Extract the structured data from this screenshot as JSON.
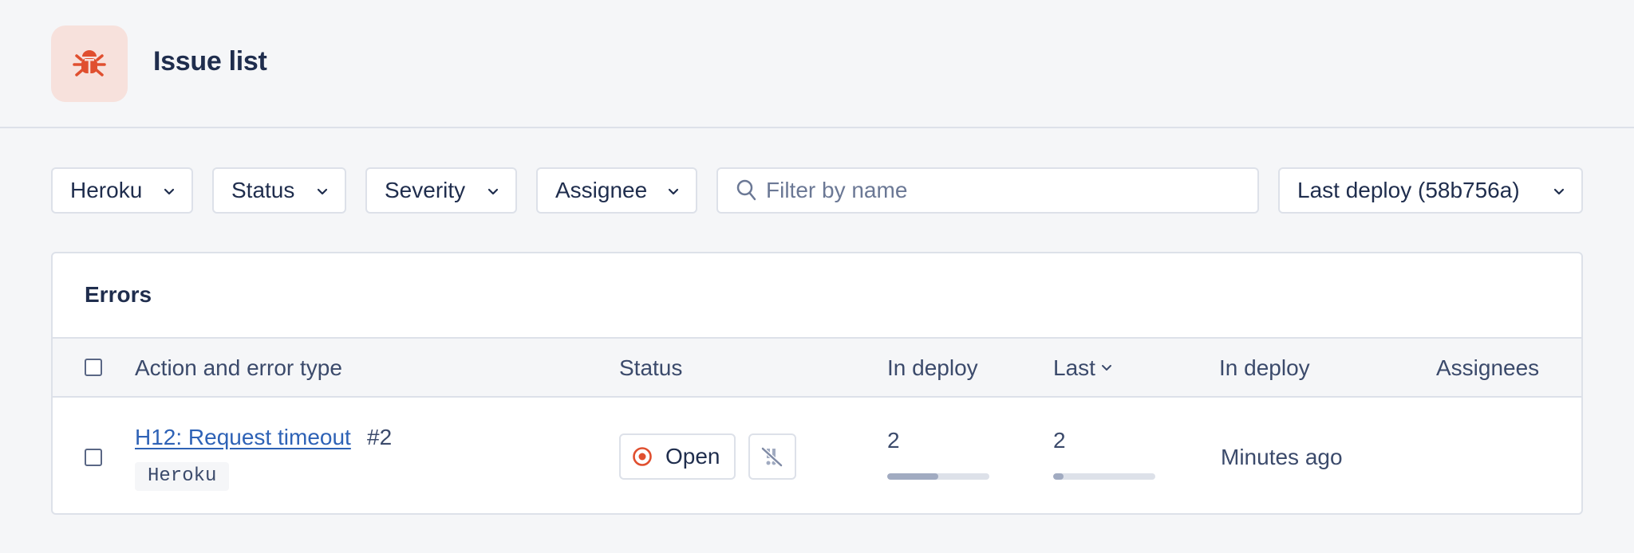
{
  "header": {
    "title": "Issue list",
    "icon": "bug-icon",
    "icon_color": "#e04f2f",
    "icon_bg": "#f7e1dc"
  },
  "filters": {
    "app": "Heroku",
    "status": "Status",
    "severity": "Severity",
    "assignee": "Assignee",
    "search_placeholder": "Filter by name",
    "search_value": "",
    "deploy": "Last deploy (58b756a)"
  },
  "errors": {
    "title": "Errors",
    "columns": {
      "action": "Action and error type",
      "status": "Status",
      "in_deploy": "In deploy",
      "last": "Last",
      "in_deploy_time": "In deploy",
      "assignees": "Assignees"
    },
    "rows": [
      {
        "name": "H12: Request timeout",
        "number": "#2",
        "tag": "Heroku",
        "status": "Open",
        "status_color": "#e04f2f",
        "in_deploy": "2",
        "in_deploy_fraction": 0.5,
        "last": "2",
        "last_fraction": 0.1,
        "time": "Minutes ago",
        "assignees": ""
      }
    ]
  },
  "colors": {
    "link": "#2e62b6",
    "text": "#1f2d4d",
    "muted": "#3b4a6b",
    "border": "#dde1e9",
    "background": "#f5f6f8"
  }
}
